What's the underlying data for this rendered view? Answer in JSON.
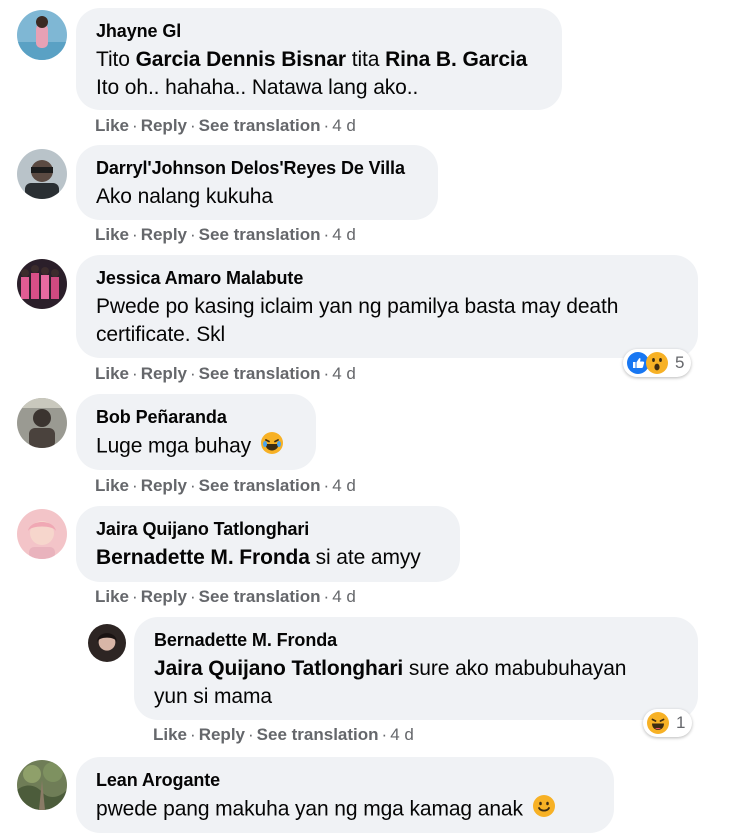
{
  "comments": [
    {
      "author": "Jhayne Gl",
      "lines": [
        [
          {
            "t": "Tito ",
            "b": false
          },
          {
            "t": "Garcia Dennis Bisnar",
            "b": true
          },
          {
            "t": " tita ",
            "b": false
          },
          {
            "t": "Rina B. Garcia",
            "b": true
          }
        ],
        [
          {
            "t": "Ito oh.. hahaha.. Natawa lang ako..",
            "b": false
          }
        ]
      ],
      "actions": {
        "like": "Like",
        "reply": "Reply",
        "translate": "See translation",
        "time": "4 d"
      }
    },
    {
      "author": "Darryl'Johnson Delos'Reyes De Villa",
      "lines": [
        [
          {
            "t": "Ako nalang kukuha",
            "b": false
          }
        ]
      ],
      "actions": {
        "like": "Like",
        "reply": "Reply",
        "translate": "See translation",
        "time": "4 d"
      }
    },
    {
      "author": "Jessica Amaro Malabute",
      "lines": [
        [
          {
            "t": "Pwede po kasing iclaim yan ng pamilya basta may death",
            "b": false
          }
        ],
        [
          {
            "t": "certificate. Skl",
            "b": false
          }
        ]
      ],
      "actions": {
        "like": "Like",
        "reply": "Reply",
        "translate": "See translation",
        "time": "4 d"
      },
      "reactions": {
        "icons": [
          "like-icon",
          "wow-icon"
        ],
        "count": "5"
      }
    },
    {
      "author": "Bob Peñaranda",
      "lines": [
        [
          {
            "t": "Luge mga buhay",
            "b": false
          }
        ]
      ],
      "emoji": "laughing-emoji-icon",
      "actions": {
        "like": "Like",
        "reply": "Reply",
        "translate": "See translation",
        "time": "4 d"
      }
    },
    {
      "author": "Jaira Quijano Tatlonghari",
      "lines": [
        [
          {
            "t": "Bernadette M. Fronda",
            "b": true
          },
          {
            "t": " si ate amyy",
            "b": false
          }
        ]
      ],
      "actions": {
        "like": "Like",
        "reply": "Reply",
        "translate": "See translation",
        "time": "4 d"
      }
    },
    {
      "author": "Bernadette M. Fronda",
      "reply": true,
      "lines": [
        [
          {
            "t": "Jaira Quijano Tatlonghari",
            "b": true
          },
          {
            "t": " sure ako mabubuhayan",
            "b": false
          }
        ],
        [
          {
            "t": "yun si mama",
            "b": false
          }
        ]
      ],
      "actions": {
        "like": "Like",
        "reply": "Reply",
        "translate": "See translation",
        "time": "4 d"
      },
      "reactions": {
        "icons": [
          "haha-icon"
        ],
        "count": "1"
      }
    },
    {
      "author": "Lean Arogante",
      "lines": [
        [
          {
            "t": "pwede pang makuha yan ng mga kamag anak",
            "b": false
          }
        ]
      ],
      "emoji": "smiling-emoji-icon"
    }
  ],
  "colors": {
    "bubble": "#f0f2f5",
    "secondary_text": "#65676b",
    "like_blue": "#1877f2",
    "reaction_yellow": "#f7b125"
  }
}
